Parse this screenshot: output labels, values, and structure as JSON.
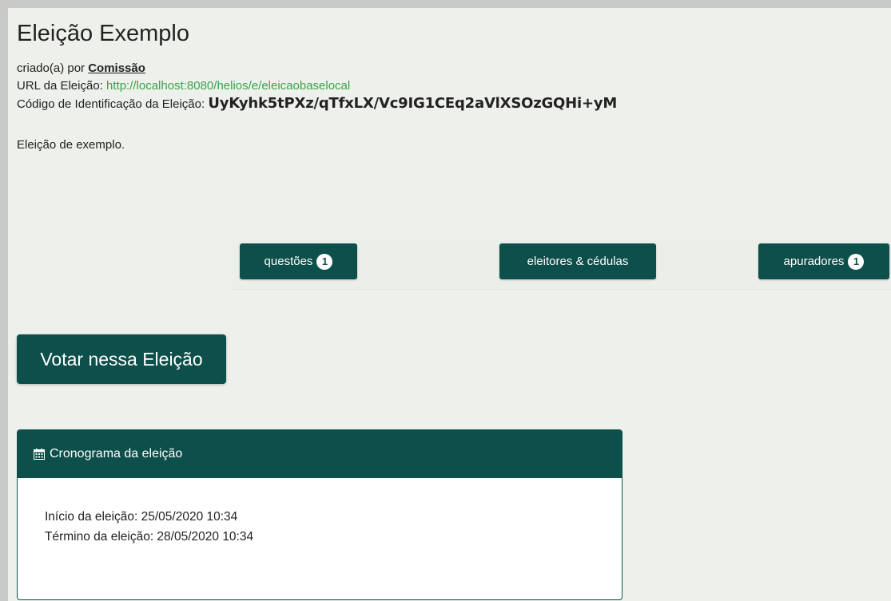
{
  "election": {
    "title": "Eleição Exemplo",
    "created_by_prefix": "criado(a) por ",
    "created_by": "Comissão",
    "url_label": "URL da Eleição: ",
    "url": "http://localhost:8080/helios/e/eleicaobaselocal",
    "hash_label": "Código de Identificação da Eleição: ",
    "hash": "UyKyhk5tPXz/qTfxLX/Vc9IG1CEq2aVlXSOzGQHi+yM",
    "description": "Eleição de exemplo."
  },
  "tabs": {
    "questions_label": "questões",
    "questions_count": "1",
    "voters_label": "eleitores & cédulas",
    "trustees_label": "apuradores",
    "trustees_count": "1"
  },
  "vote_button": "Votar nessa Eleição",
  "schedule": {
    "icon": "calendar-icon",
    "title": "Cronograma da eleição",
    "start": "Início da eleição: 25/05/2020 10:34",
    "end": "Término da eleição: 28/05/2020 10:34"
  },
  "colors": {
    "primary": "#0d4f4a",
    "link": "#3aa24a",
    "background": "#eef0ec"
  }
}
